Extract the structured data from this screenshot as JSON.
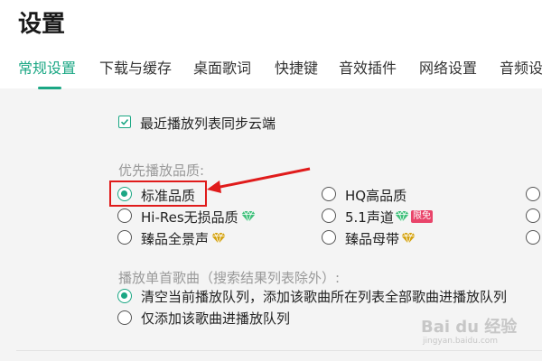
{
  "header": {
    "title": "设置"
  },
  "tabs": [
    {
      "label": "常规设置",
      "active": true
    },
    {
      "label": "下载与缓存"
    },
    {
      "label": "桌面歌词"
    },
    {
      "label": "快捷键"
    },
    {
      "label": "音效插件"
    },
    {
      "label": "网络设置"
    },
    {
      "label": "音频设"
    }
  ],
  "sync_option": {
    "label": "最近播放列表同步云端",
    "checked": true
  },
  "quality": {
    "heading": "优先播放品质:",
    "options": [
      {
        "label": "标准品质",
        "selected": true
      },
      {
        "label": "HQ高品质"
      },
      {
        "label": "Hi-Res无损品质",
        "badge": "diamond-green-icon"
      },
      {
        "label": "5.1声道",
        "badge": "diamond-green-icon",
        "tag": "限免"
      },
      {
        "label": "臻品全景声",
        "badge": "diamond-gold-icon"
      },
      {
        "label": "臻品母带",
        "badge": "diamond-gold-icon"
      }
    ]
  },
  "single_song": {
    "heading": "播放单首歌曲（搜索结果列表除外）:",
    "options": [
      {
        "label": "清空当前播放队列，添加该歌曲所在列表全部歌曲进播放队列",
        "selected": true
      },
      {
        "label": "仅添加该歌曲进播放队列"
      }
    ]
  },
  "watermark": {
    "text": "Bai du 经验",
    "sub": "jingyan.baidu.com"
  },
  "colors": {
    "accent": "#1ba784",
    "annotation": "#e01b1b",
    "tag": "#e9446a"
  }
}
